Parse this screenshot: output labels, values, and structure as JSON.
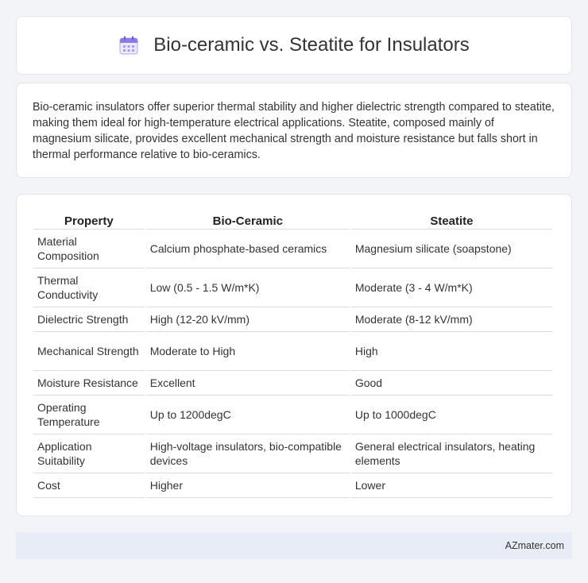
{
  "header": {
    "title": "Bio-ceramic vs. Steatite for Insulators",
    "icon": "calendar-icon"
  },
  "summary": "Bio-ceramic insulators offer superior thermal stability and higher dielectric strength compared to steatite, making them ideal for high-temperature electrical applications. Steatite, composed mainly of magnesium silicate, provides excellent mechanical strength and moisture resistance but falls short in thermal performance relative to bio-ceramics.",
  "table": {
    "headers": [
      "Property",
      "Bio-Ceramic",
      "Steatite"
    ],
    "rows": [
      [
        "Material Composition",
        "Calcium phosphate-based ceramics",
        "Magnesium silicate (soapstone)"
      ],
      [
        "Thermal Conductivity",
        "Low (0.5 - 1.5 W/m*K)",
        "Moderate (3 - 4 W/m*K)"
      ],
      [
        "Dielectric Strength",
        "High (12-20 kV/mm)",
        "Moderate (8-12 kV/mm)"
      ],
      [
        "Mechanical Strength",
        "Moderate to High",
        "High"
      ],
      [
        "Moisture Resistance",
        "Excellent",
        "Good"
      ],
      [
        "Operating Temperature",
        "Up to 1200degC",
        "Up to 1000degC"
      ],
      [
        "Application Suitability",
        "High-voltage insulators, bio-compatible devices",
        "General electrical insulators, heating elements"
      ],
      [
        "Cost",
        "Higher",
        "Lower"
      ]
    ]
  },
  "footer": {
    "site": "AZmater.com"
  }
}
